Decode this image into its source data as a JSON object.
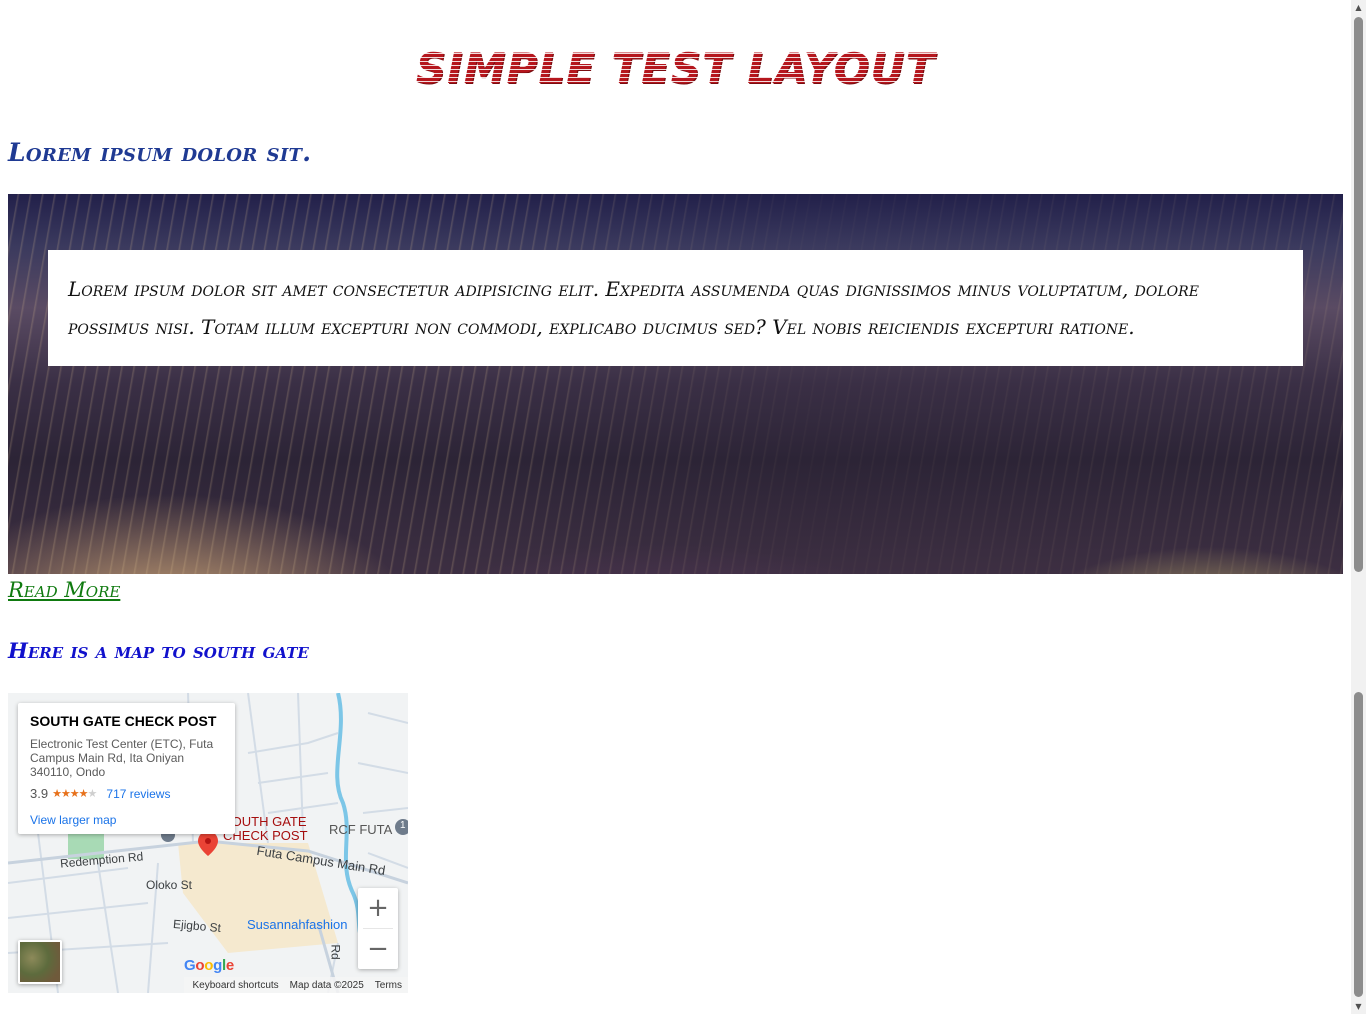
{
  "page": {
    "title": "SIMPLE TEST LAYOUT",
    "subheading": "Lorem ipsum dolor sit.",
    "hero_text": "Lorem ipsum dolor sit amet consectetur adipisicing elit. Expedita assumenda quas dignissimos minus voluptatum, dolore possimus nisi. Totam illum excepturi non commodi, explicabo ducimus sed? Vel nobis reiciendis excepturi ratione.",
    "read_more": "Read More",
    "map_heading": "Here is a map to south gate"
  },
  "map": {
    "place_name": "SOUTH GATE CHECK POST",
    "address": "Electronic Test Center (ETC), Futa Campus Main Rd, Ita Oniyan 340110, Ondo",
    "rating": "3.9",
    "stars": "★★★★",
    "star_empty": "★",
    "reviews": "717 reviews",
    "larger_map": "View larger map",
    "labels": {
      "marker_label_1": "SOUTH GATE",
      "marker_label_2": "CHECK POST",
      "rcf": "RCF FUTA",
      "redemption": "Redemption Rd",
      "futa_main": "Futa Campus Main Rd",
      "oloko": "Oloko St",
      "ejigbo": "Ejigbo St",
      "susannah": "Susannahfashion",
      "rd": "Rd",
      "badge": "1"
    },
    "zoom_in": "+",
    "zoom_out": "−",
    "google": [
      "G",
      "o",
      "o",
      "g",
      "l",
      "e"
    ],
    "footer": {
      "shortcuts": "Keyboard shortcuts",
      "map_data": "Map data ©2025",
      "terms": "Terms"
    }
  },
  "colors": {
    "title_red": "#b5161d",
    "subheading_blue": "#1f3a93",
    "link_green": "#0f7a0f",
    "map_heading_blue": "#1111cc",
    "marker_red": "#ea4335",
    "link_blue": "#1a73e8"
  },
  "icons": {
    "marker": "map-pin-icon",
    "zoom_in": "plus-icon",
    "zoom_out": "minus-icon",
    "scroll_up": "triangle-up-icon",
    "scroll_down": "triangle-down-icon"
  }
}
